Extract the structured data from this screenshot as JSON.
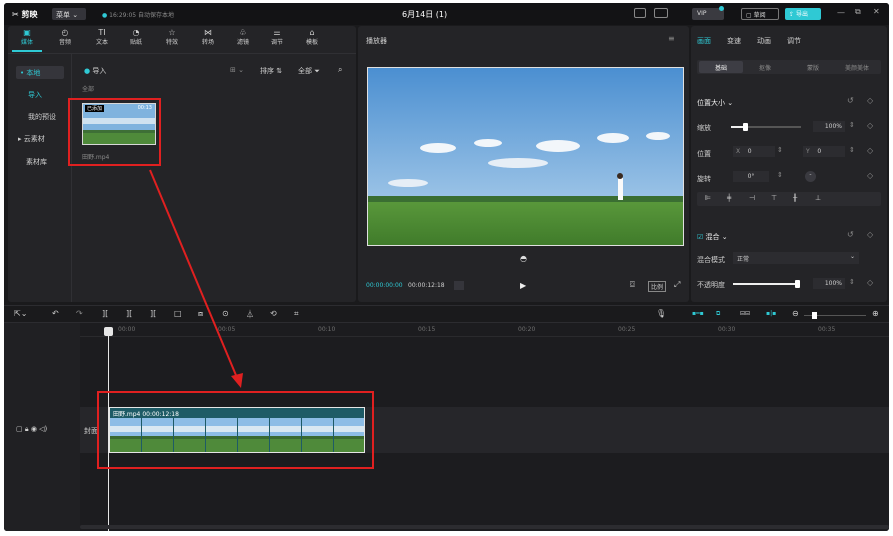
{
  "app": {
    "name": "剪映",
    "menu": "菜单",
    "autosave": "16:29:05 自动保存本地",
    "title": "6月14日 (1)",
    "vip": "VIP",
    "shortcut": "草阅",
    "export": "导出"
  },
  "toolbar_tabs": [
    {
      "label": "媒体",
      "icon": "media-icon"
    },
    {
      "label": "音频",
      "icon": "audio-icon"
    },
    {
      "label": "文本",
      "icon": "text-icon"
    },
    {
      "label": "贴纸",
      "icon": "sticker-icon"
    },
    {
      "label": "特效",
      "icon": "effects-icon"
    },
    {
      "label": "转场",
      "icon": "transition-icon"
    },
    {
      "label": "滤镜",
      "icon": "filter-icon"
    },
    {
      "label": "调节",
      "icon": "adjust-icon"
    },
    {
      "label": "模板",
      "icon": "template-icon"
    }
  ],
  "sidebar": {
    "items": [
      {
        "label": "• 本地"
      },
      {
        "label": "导入"
      },
      {
        "label": "我的预设"
      },
      {
        "label": "▸ 云素材"
      },
      {
        "label": "素材库"
      }
    ]
  },
  "media": {
    "import_label": "导入",
    "filter_all": "全部",
    "sort_label": "排序",
    "all_label": "全部",
    "clip": {
      "badge": "已添加",
      "duration": "00:13",
      "name": "田野.mp4"
    }
  },
  "player": {
    "title": "播放器",
    "current_time": "00:00:00:00",
    "total_time": "00:00:12:18",
    "ratio": "比例"
  },
  "right_panel": {
    "tabs": [
      "画面",
      "变速",
      "动画",
      "调节"
    ],
    "subtabs": [
      "基础",
      "抠像",
      "蒙版",
      "美颜美体"
    ],
    "position_size": "位置大小",
    "scale_label": "缩放",
    "scale_value": "100%",
    "position_label": "位置",
    "x_label": "X",
    "x_value": "0",
    "y_label": "Y",
    "y_value": "0",
    "rotate_label": "旋转",
    "rotate_value": "0°",
    "blend_label": "混合",
    "blend_mode_label": "混合模式",
    "blend_mode_value": "正常",
    "opacity_label": "不透明度",
    "opacity_value": "100%"
  },
  "timeline": {
    "ticks": [
      "00:00",
      "00:05",
      "00:10",
      "00:15",
      "00:20",
      "00:25",
      "00:30",
      "00:35"
    ],
    "cover_label": "封面",
    "clip_name": "田野.mp4",
    "clip_duration": "00:00:12:18"
  },
  "colors": {
    "accent": "#2fc9d4",
    "annotation": "#e02020"
  }
}
